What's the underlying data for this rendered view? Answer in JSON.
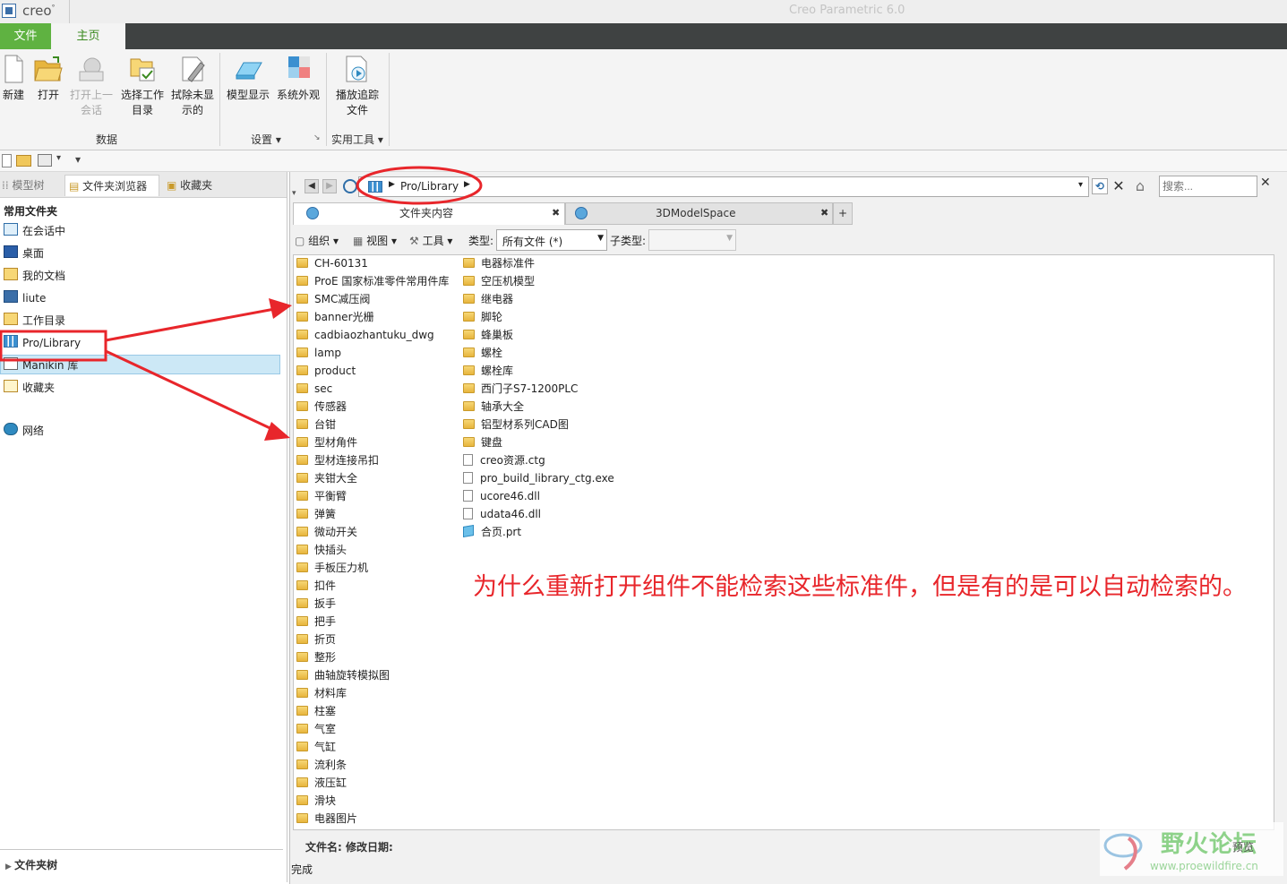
{
  "titlebar": {
    "brand": "creo",
    "brand_mark": "°",
    "window_title": "Creo Parametric 6.0"
  },
  "ribbon_tabs": {
    "file": "文件",
    "home": "主页"
  },
  "ribbon": {
    "new": "新建",
    "open": "打开",
    "open_last_session": "打开上一\n会话",
    "select_working_dir": "选择工作\n目录",
    "erase_not_displayed": "拭除未显\n示的",
    "data_group": "数据",
    "model_display": "模型显示",
    "system_appearance": "系统外观",
    "settings_group": "设置",
    "play_trail": "播放追踪\n文件",
    "utilities_group": "实用工具"
  },
  "left_panel": {
    "tabs": {
      "model_tree": "模型树",
      "folder_browser": "文件夹浏览器",
      "favorites": "收藏夹"
    },
    "header": "常用文件夹",
    "items": [
      "在会话中",
      "桌面",
      "我的文档",
      "liute",
      "工作目录",
      "Pro/Library",
      "Manikin 库",
      "收藏夹",
      "网络"
    ],
    "footer": "文件夹树"
  },
  "address": {
    "path": "Pro/Library",
    "search_placeholder": "搜索..."
  },
  "content_tabs": {
    "tab1": "文件夹内容",
    "tab2": "3DModelSpace",
    "add": "+"
  },
  "toolbar": {
    "organize": "组织",
    "view": "视图",
    "tools": "工具",
    "type_label": "类型:",
    "type_value": "所有文件 (*)",
    "subtype_label": "子类型:"
  },
  "files_col1": [
    "CH-60131",
    "ProE 国家标准零件常用件库",
    "SMC减压阀",
    "banner光栅",
    "cadbiaozhantuku_dwg",
    "lamp",
    "product",
    "sec",
    "传感器",
    "台钳",
    "型材角件",
    "型材连接吊扣",
    "夹钳大全",
    "平衡臂",
    "弹簧",
    "微动开关",
    "快插头",
    "手板压力机",
    "扣件",
    "扳手",
    "把手",
    "折页",
    "整形",
    "曲轴旋转模拟图",
    "材料库",
    "柱塞",
    "气室",
    "气缸",
    "流利条",
    "液压缸",
    "滑块",
    "电器图片"
  ],
  "files_col2_folders": [
    "电器标准件",
    "空压机模型",
    "继电器",
    "脚轮",
    "蜂巢板",
    "螺栓",
    "螺栓库",
    "西门子S7-1200PLC",
    "轴承大全",
    "铝型材系列CAD图",
    "键盘"
  ],
  "files_col2_files": [
    {
      "name": "creo资源.ctg",
      "kind": "doc"
    },
    {
      "name": "pro_build_library_ctg.exe",
      "kind": "exe"
    },
    {
      "name": "ucore46.dll",
      "kind": "dll"
    },
    {
      "name": "udata46.dll",
      "kind": "dll"
    },
    {
      "name": "合页.prt",
      "kind": "prt"
    }
  ],
  "annotation": "为什么重新打开组件不能检索这些标准件，但是有的是可以自动检索的。",
  "info_bar": "文件名:  修改日期:",
  "status": "完成",
  "watermark": {
    "text": "野火论坛",
    "url": "www.proewildfire.cn",
    "preview": "预览"
  },
  "colors": {
    "accent_green": "#5fb241",
    "annotation_red": "#e8262b",
    "tab_dark": "#3f4242"
  }
}
